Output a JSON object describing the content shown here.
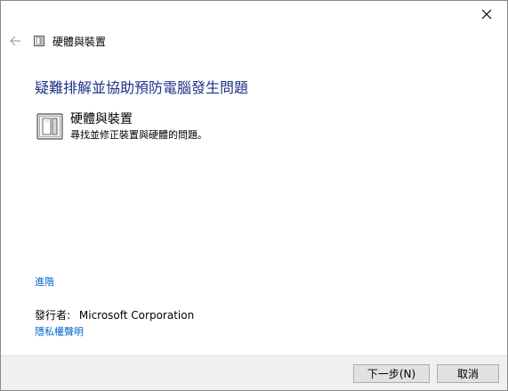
{
  "window": {
    "close_icon": "close-icon"
  },
  "nav": {
    "back_icon": "back-arrow-icon",
    "item_icon": "hardware-device-icon",
    "title": "硬體與裝置"
  },
  "main": {
    "heading": "疑難排解並協助預防電腦發生問題",
    "item": {
      "icon": "hardware-device-icon",
      "title": "硬體與裝置",
      "description": "尋找並修正裝置與硬體的問題。"
    },
    "advanced_link": "進階",
    "publisher_label": "發行者:",
    "publisher_value": "Microsoft Corporation",
    "privacy_link": "隱私權聲明"
  },
  "footer": {
    "next_label": "下一步(N)",
    "cancel_label": "取消"
  },
  "colors": {
    "heading": "#1e3287",
    "link": "#0066cc",
    "footer_bg": "#f0f0f0"
  }
}
